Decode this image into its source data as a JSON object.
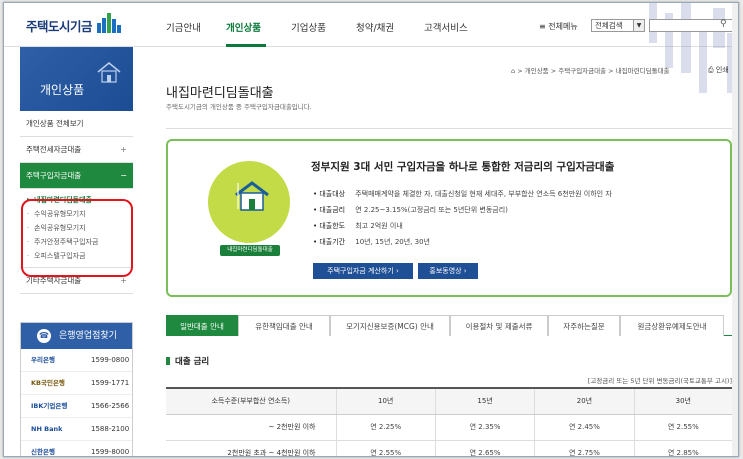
{
  "header": {
    "logo_text": "주택도시기금",
    "nav": [
      "기금안내",
      "개인상품",
      "기업상품",
      "청약/채권",
      "고객서비스"
    ],
    "active_nav": "개인상품",
    "all_menu": "≡ 전체메뉴",
    "search_select": "전체검색",
    "search_placeholder": ""
  },
  "sidebar": {
    "title": "개인상품",
    "items": [
      {
        "label": "개인상품 전체보기"
      },
      {
        "label": "주택전세자금대출",
        "toggle": "+"
      },
      {
        "label": "주택구입자금대출",
        "toggle": "−"
      }
    ],
    "sub_items": [
      "내집마련디딤돌대출",
      "수익공유형모기지",
      "손익공유형모기지",
      "주거안정주택구입자금",
      "오피스텔구입자금"
    ],
    "other_item": {
      "label": "기타주택자금대출",
      "toggle": "+"
    },
    "bank_box": {
      "title": "은행영업점찾기",
      "banks": [
        {
          "name": "우리은행",
          "phone": "1599-0800"
        },
        {
          "name": "KB국민은행",
          "phone": "1599-1771"
        },
        {
          "name": "IBK기업은행",
          "phone": "1566-2566"
        },
        {
          "name": "NH Bank",
          "phone": "1588-2100"
        },
        {
          "name": "신한은행",
          "phone": "1599-8000"
        }
      ]
    }
  },
  "main": {
    "title": "내집마련디딤돌대출",
    "subtitle": "주택도시기금의 개인상품 중 주택구입자금대출입니다.",
    "breadcrumb": [
      "개인상품",
      "주택구입자금대출",
      "내집마련디딤돌대출"
    ],
    "print_label": "인쇄",
    "promo": {
      "badge": "내집마련디딤돌대출",
      "title": "정부지원 3대 서민 구입자금을 하나로 통합한 저금리의 구입자금대출",
      "rows": [
        {
          "key": "대출대상",
          "value": "주택매매계약을 체결한 자, 대출신청일 현재 세대주, 부부합산 연소득 6천만원 이하인 자"
        },
        {
          "key": "대출금리",
          "value": "연 2.25~3.15%(고정금리 또는 5년단위 변동금리)"
        },
        {
          "key": "대출한도",
          "value": "최고 2억원 이내"
        },
        {
          "key": "대출기간",
          "value": "10년, 15년, 20년, 30년"
        }
      ],
      "btn_calc": "주택구입자금 계산하기 ›",
      "btn_video": "홍보동영상 ›"
    },
    "tabs": [
      "일반대출 안내",
      "유한책임대출 안내",
      "모기지신용보증(MCG) 안내",
      "이용절차 및 제출서류",
      "자주하는질문",
      "원금상환유예제도안내"
    ],
    "active_tab": 0,
    "section_title": "대출 금리",
    "table_note": "[고정금리 또는 5년 단위 변동금리(국토교통부 고시)]",
    "table": {
      "headers": [
        "소득수준(부부합산 연소득)",
        "10년",
        "15년",
        "20년",
        "30년"
      ],
      "rows": [
        [
          "~ 2천만원 이하",
          "연 2.25%",
          "연 2.35%",
          "연 2.45%",
          "연 2.55%"
        ],
        [
          "2천만원 초과 ~ 4천만원 이하",
          "연 2.55%",
          "연 2.65%",
          "연 2.75%",
          "연 2.85%"
        ]
      ]
    }
  },
  "colors": {
    "brand_green": "#1f8a3f",
    "brand_blue": "#2f5fa7",
    "highlight_red": "#e0161c"
  }
}
